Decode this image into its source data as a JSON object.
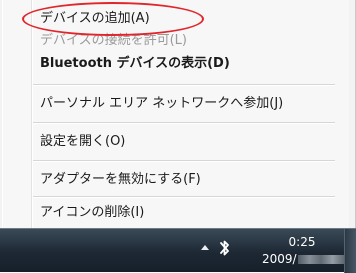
{
  "context_menu": {
    "items": [
      {
        "label": "デバイスの追加(A)"
      },
      {
        "label": "デバイスの接続を許可(L)"
      },
      {
        "label": "Bluetooth デバイスの表示(D)"
      },
      {
        "label": "パーソナル エリア ネットワークへ参加(J)"
      },
      {
        "label": "設定を開く(O)"
      },
      {
        "label": "アダプターを無効にする(F)"
      },
      {
        "label": "アイコンの削除(I)"
      }
    ]
  },
  "taskbar": {
    "clock_time": "0:25",
    "clock_date": "2009/"
  },
  "colors": {
    "highlight_ellipse": "#e0262b",
    "disabled_text": "#9a9a9a",
    "taskbar": "#1d2834"
  },
  "icons": [
    "show-hidden-icons-arrow-icon",
    "bluetooth-icon"
  ]
}
